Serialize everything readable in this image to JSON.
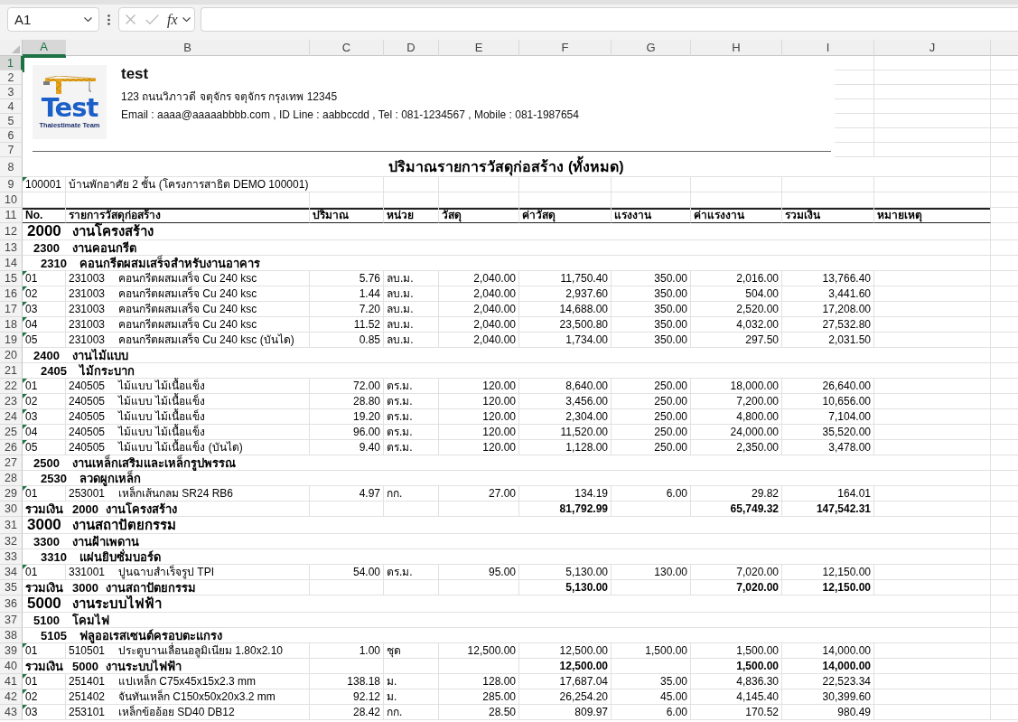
{
  "formula_bar": {
    "name_box": "A1",
    "edit_buttons_disabled": true,
    "function_label": "fx"
  },
  "sheet": {
    "columns": [
      {
        "label": "A",
        "selected": true
      },
      {
        "label": "B",
        "selected": false
      },
      {
        "label": "C",
        "selected": false
      },
      {
        "label": "D",
        "selected": false
      },
      {
        "label": "E",
        "selected": false
      },
      {
        "label": "F",
        "selected": false
      },
      {
        "label": "G",
        "selected": false
      },
      {
        "label": "H",
        "selected": false
      },
      {
        "label": "I",
        "selected": false
      },
      {
        "label": "J",
        "selected": false
      }
    ],
    "header_block": {
      "logo": {
        "wordmark": "Test",
        "tagline": "Thaiestimate Team"
      },
      "company_name": "test",
      "address": "123 ถนนวิภาวดี จตุจักร จตุจักร กรุงเทพ 12345",
      "contact": "Email : aaaa@aaaaabbbb.com , ID Line : aabbccdd , Tel : 081-1234567 , Mobile : 081-1987654"
    },
    "rows": [
      {
        "number": "1",
        "selected": true,
        "kind": "header"
      },
      {
        "number": "2",
        "selected": false,
        "kind": "header"
      },
      {
        "number": "3",
        "selected": false,
        "kind": "header"
      },
      {
        "number": "4",
        "selected": false,
        "kind": "header"
      },
      {
        "number": "5",
        "selected": false,
        "kind": "header"
      },
      {
        "number": "6",
        "selected": false,
        "kind": "header"
      },
      {
        "number": "7",
        "selected": false,
        "kind": "header"
      },
      {
        "number": "8",
        "selected": false,
        "kind": "title",
        "text": "ปริมาณรายการวัสดุก่อสร้าง (ทั้งหมด)"
      },
      {
        "number": "9",
        "selected": false,
        "kind": "project",
        "code": "100001",
        "name": "บ้านพักอาศัย 2 ชั้น (โครงการสาธิต DEMO 100001)",
        "warning": true
      },
      {
        "number": "10",
        "selected": false,
        "kind": "blank"
      },
      {
        "number": "11",
        "selected": false,
        "kind": "table_header",
        "cells": [
          "No.",
          "รายการวัสดุก่อสร้าง",
          "ปริมาณ",
          "หน่วย",
          "วัสดุ",
          "ค่าวัสดุ",
          "แรงงาน",
          "ค่าแรงงาน",
          "รวมเงิน",
          "หมายเหตุ"
        ]
      },
      {
        "number": "12",
        "selected": false,
        "kind": "group",
        "code": "2000",
        "name": "งานโครงสร้าง",
        "children": [
          {
            "number": "13",
            "selected": false,
            "kind": "group",
            "code": "2300",
            "name": "งานคอนกรีต",
            "children": [
              {
                "number": "14",
                "selected": false,
                "kind": "group",
                "code": "2310",
                "name": "คอนกรีตผสมเสร็จสำหรับงานอาคาร",
                "children": [
                  {
                    "number": "15",
                    "selected": false,
                    "kind": "item",
                    "warning": true,
                    "no": "01",
                    "code": "231003",
                    "description": "คอนกรีตผสมเสร็จ Cu 240 ksc",
                    "quantity": "5.76",
                    "unit": "ลบ.ม.",
                    "material_rate": "2,040.00",
                    "material_cost": "11,750.40",
                    "labor_rate": "350.00",
                    "labor_cost": "2,016.00",
                    "total": "13,766.40"
                  },
                  {
                    "number": "16",
                    "selected": false,
                    "kind": "item",
                    "warning": true,
                    "no": "02",
                    "code": "231003",
                    "description": "คอนกรีตผสมเสร็จ Cu 240 ksc",
                    "quantity": "1.44",
                    "unit": "ลบ.ม.",
                    "material_rate": "2,040.00",
                    "material_cost": "2,937.60",
                    "labor_rate": "350.00",
                    "labor_cost": "504.00",
                    "total": "3,441.60"
                  },
                  {
                    "number": "17",
                    "selected": false,
                    "kind": "item",
                    "warning": true,
                    "no": "03",
                    "code": "231003",
                    "description": "คอนกรีตผสมเสร็จ Cu 240 ksc",
                    "quantity": "7.20",
                    "unit": "ลบ.ม.",
                    "material_rate": "2,040.00",
                    "material_cost": "14,688.00",
                    "labor_rate": "350.00",
                    "labor_cost": "2,520.00",
                    "total": "17,208.00"
                  },
                  {
                    "number": "18",
                    "selected": false,
                    "kind": "item",
                    "warning": true,
                    "no": "04",
                    "code": "231003",
                    "description": "คอนกรีตผสมเสร็จ Cu 240 ksc",
                    "quantity": "11.52",
                    "unit": "ลบ.ม.",
                    "material_rate": "2,040.00",
                    "material_cost": "23,500.80",
                    "labor_rate": "350.00",
                    "labor_cost": "4,032.00",
                    "total": "27,532.80"
                  },
                  {
                    "number": "19",
                    "selected": false,
                    "kind": "item",
                    "warning": true,
                    "no": "05",
                    "code": "231003",
                    "description": "คอนกรีตผสมเสร็จ Cu 240 ksc (บันได)",
                    "quantity": "0.85",
                    "unit": "ลบ.ม.",
                    "material_rate": "2,040.00",
                    "material_cost": "1,734.00",
                    "labor_rate": "350.00",
                    "labor_cost": "297.50",
                    "total": "2,031.50"
                  }
                ]
              }
            ]
          },
          {
            "number": "20",
            "selected": false,
            "kind": "group",
            "code": "2400",
            "name": "งานไม้แบบ",
            "children": [
              {
                "number": "21",
                "selected": false,
                "kind": "group",
                "code": "2405",
                "name": "ไม้กระบาก",
                "children": [
                  {
                    "number": "22",
                    "selected": false,
                    "kind": "item",
                    "warning": true,
                    "no": "01",
                    "code": "240505",
                    "description": "ไม้แบบ ไม้เนื้อแข็ง",
                    "quantity": "72.00",
                    "unit": "ตร.ม.",
                    "material_rate": "120.00",
                    "material_cost": "8,640.00",
                    "labor_rate": "250.00",
                    "labor_cost": "18,000.00",
                    "total": "26,640.00"
                  },
                  {
                    "number": "23",
                    "selected": false,
                    "kind": "item",
                    "warning": true,
                    "no": "02",
                    "code": "240505",
                    "description": "ไม้แบบ ไม้เนื้อแข็ง",
                    "quantity": "28.80",
                    "unit": "ตร.ม.",
                    "material_rate": "120.00",
                    "material_cost": "3,456.00",
                    "labor_rate": "250.00",
                    "labor_cost": "7,200.00",
                    "total": "10,656.00"
                  },
                  {
                    "number": "24",
                    "selected": false,
                    "kind": "item",
                    "warning": true,
                    "no": "03",
                    "code": "240505",
                    "description": "ไม้แบบ ไม้เนื้อแข็ง",
                    "quantity": "19.20",
                    "unit": "ตร.ม.",
                    "material_rate": "120.00",
                    "material_cost": "2,304.00",
                    "labor_rate": "250.00",
                    "labor_cost": "4,800.00",
                    "total": "7,104.00"
                  },
                  {
                    "number": "25",
                    "selected": false,
                    "kind": "item",
                    "warning": true,
                    "no": "04",
                    "code": "240505",
                    "description": "ไม้แบบ ไม้เนื้อแข็ง",
                    "quantity": "96.00",
                    "unit": "ตร.ม.",
                    "material_rate": "120.00",
                    "material_cost": "11,520.00",
                    "labor_rate": "250.00",
                    "labor_cost": "24,000.00",
                    "total": "35,520.00"
                  },
                  {
                    "number": "26",
                    "selected": false,
                    "kind": "item",
                    "warning": true,
                    "no": "05",
                    "code": "240505",
                    "description": "ไม้แบบ ไม้เนื้อแข็ง (บันได)",
                    "quantity": "9.40",
                    "unit": "ตร.ม.",
                    "material_rate": "120.00",
                    "material_cost": "1,128.00",
                    "labor_rate": "250.00",
                    "labor_cost": "2,350.00",
                    "total": "3,478.00"
                  }
                ]
              }
            ]
          },
          {
            "number": "27",
            "selected": false,
            "kind": "group",
            "code": "2500",
            "name": "งานเหล็กเสริมและเหล็กรูปพรรณ",
            "children": [
              {
                "number": "28",
                "selected": false,
                "kind": "group",
                "code": "2530",
                "name": "ลวดผูกเหล็ก",
                "children": [
                  {
                    "number": "29",
                    "selected": false,
                    "kind": "item",
                    "warning": true,
                    "no": "01",
                    "code": "253001",
                    "description": "เหล็กเส้นกลม SR24 RB6",
                    "quantity": "4.97",
                    "unit": "กก.",
                    "material_rate": "27.00",
                    "material_cost": "134.19",
                    "labor_rate": "6.00",
                    "labor_cost": "29.82",
                    "total": "164.01"
                  }
                ]
              }
            ]
          }
        ]
      },
      {
        "number": "30",
        "selected": false,
        "kind": "subtotal",
        "label": "รวมเงิน",
        "code": "2000",
        "name": "งานโครงสร้าง",
        "material_cost": "81,792.99",
        "labor_cost": "65,749.32",
        "total": "147,542.31"
      },
      {
        "number": "31",
        "selected": false,
        "kind": "group",
        "code": "3000",
        "name": "งานสถาปัตยกรรม",
        "children": [
          {
            "number": "32",
            "selected": false,
            "kind": "group",
            "code": "3300",
            "name": "งานฝ้าเพดาน",
            "children": [
              {
                "number": "33",
                "selected": false,
                "kind": "group",
                "code": "3310",
                "name": "แผ่นยิบซั่มบอร์ด",
                "children": [
                  {
                    "number": "34",
                    "selected": false,
                    "kind": "item",
                    "warning": true,
                    "no": "01",
                    "code": "331001",
                    "description": "ปูนฉาบสำเร็จรูป TPI",
                    "quantity": "54.00",
                    "unit": "ตร.ม.",
                    "material_rate": "95.00",
                    "material_cost": "5,130.00",
                    "labor_rate": "130.00",
                    "labor_cost": "7,020.00",
                    "total": "12,150.00"
                  }
                ]
              }
            ]
          }
        ]
      },
      {
        "number": "35",
        "selected": false,
        "kind": "subtotal",
        "label": "รวมเงิน",
        "code": "3000",
        "name": "งานสถาปัตยกรรม",
        "material_cost": "5,130.00",
        "labor_cost": "7,020.00",
        "total": "12,150.00"
      },
      {
        "number": "36",
        "selected": false,
        "kind": "group",
        "code": "5000",
        "name": "งานระบบไฟฟ้า",
        "children": [
          {
            "number": "37",
            "selected": false,
            "kind": "group",
            "code": "5100",
            "name": "โคมไฟ",
            "children": [
              {
                "number": "38",
                "selected": false,
                "kind": "group",
                "code": "5105",
                "name": "ฟลูออเรสเซนต์ครอบตะแกรง",
                "children": [
                  {
                    "number": "39",
                    "selected": false,
                    "kind": "item",
                    "warning": true,
                    "no": "01",
                    "code": "510501",
                    "description": "ประตูบานเลื่อนอลูมิเนียม 1.80x2.10",
                    "quantity": "1.00",
                    "unit": "ชุด",
                    "material_rate": "12,500.00",
                    "material_cost": "12,500.00",
                    "labor_rate": "1,500.00",
                    "labor_cost": "1,500.00",
                    "total": "14,000.00"
                  }
                ]
              }
            ]
          }
        ]
      },
      {
        "number": "40",
        "selected": false,
        "kind": "subtotal",
        "label": "รวมเงิน",
        "code": "5000",
        "name": "งานระบบไฟฟ้า",
        "material_cost": "12,500.00",
        "labor_cost": "1,500.00",
        "total": "14,000.00"
      },
      {
        "number": "41",
        "selected": false,
        "kind": "item",
        "warning": true,
        "no": "01",
        "code": "251401",
        "description": "แปเหล็ก C75x45x15x2.3 mm",
        "quantity": "138.18",
        "unit": "ม.",
        "material_rate": "128.00",
        "material_cost": "17,687.04",
        "labor_rate": "35.00",
        "labor_cost": "4,836.30",
        "total": "22,523.34"
      },
      {
        "number": "42",
        "selected": false,
        "kind": "item",
        "warning": true,
        "no": "02",
        "code": "251402",
        "description": "จันทันเหล็ก C150x50x20x3.2 mm",
        "quantity": "92.12",
        "unit": "ม.",
        "material_rate": "285.00",
        "material_cost": "26,254.20",
        "labor_rate": "45.00",
        "labor_cost": "4,145.40",
        "total": "30,399.60"
      },
      {
        "number": "43",
        "selected": false,
        "kind": "item",
        "warning": true,
        "no": "03",
        "code": "253101",
        "description": "เหล็กข้ออ้อย SD40 DB12",
        "quantity": "28.42",
        "unit": "กก.",
        "material_rate": "28.50",
        "material_cost": "809.97",
        "labor_rate": "6.00",
        "labor_cost": "170.52",
        "total": "980.49"
      }
    ]
  }
}
